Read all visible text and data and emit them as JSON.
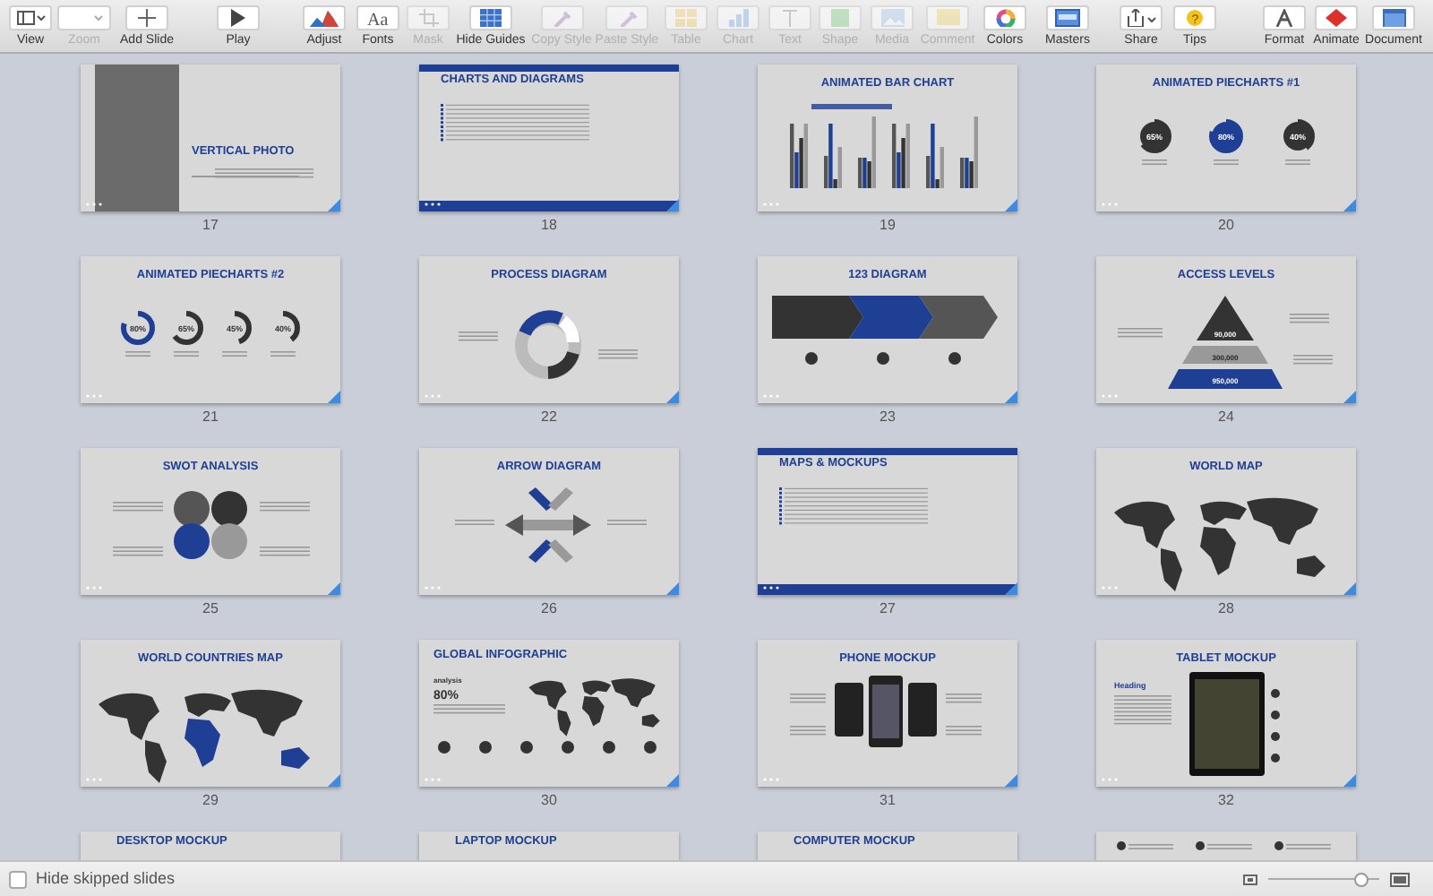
{
  "toolbar": {
    "groups": [
      {
        "items": [
          {
            "kind": "view",
            "label": "View",
            "disabled": false
          },
          {
            "kind": "zoom",
            "label": "Zoom",
            "disabled": true
          },
          {
            "kind": "add",
            "label": "Add Slide",
            "disabled": false
          }
        ]
      },
      {
        "items": [
          {
            "kind": "play",
            "label": "Play",
            "disabled": false
          }
        ]
      },
      {
        "items": [
          {
            "kind": "adjust",
            "label": "Adjust",
            "disabled": false
          },
          {
            "kind": "fonts",
            "label": "Fonts",
            "disabled": false,
            "glyph": "Aa"
          },
          {
            "kind": "mask",
            "label": "Mask",
            "disabled": true
          },
          {
            "kind": "guides",
            "label": "Hide Guides",
            "disabled": false
          },
          {
            "kind": "copystyle",
            "label": "Copy Style",
            "disabled": true
          },
          {
            "kind": "pastestyle",
            "label": "Paste Style",
            "disabled": true
          },
          {
            "kind": "table",
            "label": "Table",
            "disabled": true
          },
          {
            "kind": "chart",
            "label": "Chart",
            "disabled": true
          },
          {
            "kind": "text",
            "label": "Text",
            "disabled": true
          },
          {
            "kind": "shape",
            "label": "Shape",
            "disabled": true
          },
          {
            "kind": "media",
            "label": "Media",
            "disabled": true
          },
          {
            "kind": "comment",
            "label": "Comment",
            "disabled": true
          },
          {
            "kind": "colors",
            "label": "Colors",
            "disabled": false
          },
          {
            "kind": "masters",
            "label": "Masters",
            "disabled": false
          }
        ]
      },
      {
        "items": [
          {
            "kind": "share",
            "label": "Share",
            "disabled": false
          },
          {
            "kind": "tips",
            "label": "Tips",
            "disabled": false,
            "glyph": "?"
          }
        ]
      },
      {
        "items": [
          {
            "kind": "format",
            "label": "Format",
            "disabled": false
          },
          {
            "kind": "animate",
            "label": "Animate",
            "disabled": false
          },
          {
            "kind": "document",
            "label": "Document",
            "disabled": false
          }
        ]
      }
    ]
  },
  "slides": [
    {
      "number": "17",
      "kind": "photo",
      "title": "VERTICAL PHOTO"
    },
    {
      "number": "18",
      "kind": "list",
      "title": "CHARTS AND DIAGRAMS"
    },
    {
      "number": "19",
      "kind": "bars",
      "title": "ANIMATED BAR CHART"
    },
    {
      "number": "20",
      "kind": "pies",
      "title": "ANIMATED PIECHARTS #1",
      "values": [
        "65%",
        "80%",
        "40%"
      ]
    },
    {
      "number": "21",
      "kind": "pies",
      "title": "ANIMATED PIECHARTS #2",
      "values": [
        "80%",
        "65%",
        "45%",
        "40%"
      ]
    },
    {
      "number": "22",
      "kind": "cycle",
      "title": "PROCESS DIAGRAM"
    },
    {
      "number": "23",
      "kind": "chevrons",
      "title": "123 DIAGRAM"
    },
    {
      "number": "24",
      "kind": "pyramid",
      "title": "ACCESS LEVELS",
      "values": [
        "90,000",
        "300,000",
        "950,000"
      ]
    },
    {
      "number": "25",
      "kind": "venn",
      "title": "SWOT ANALYSIS"
    },
    {
      "number": "26",
      "kind": "arrows",
      "title": "ARROW DIAGRAM"
    },
    {
      "number": "27",
      "kind": "list",
      "title": "MAPS & MOCKUPS"
    },
    {
      "number": "28",
      "kind": "map",
      "title": "WORLD MAP"
    },
    {
      "number": "29",
      "kind": "map",
      "title": "WORLD COUNTRIES MAP"
    },
    {
      "number": "30",
      "kind": "infographic",
      "title": "GLOBAL INFOGRAPHIC",
      "values": [
        "analysis",
        "80%"
      ]
    },
    {
      "number": "31",
      "kind": "phones",
      "title": "PHONE MOCKUP"
    },
    {
      "number": "32",
      "kind": "tablet",
      "title": "TABLET MOCKUP",
      "values": [
        "Heading"
      ]
    },
    {
      "kind": "mockup",
      "title": "DESKTOP MOCKUP"
    },
    {
      "kind": "mockup",
      "title": "LAPTOP MOCKUP"
    },
    {
      "kind": "mockup",
      "title": "COMPUTER MOCKUP"
    },
    {
      "kind": "icons"
    }
  ],
  "status_bar": {
    "hide_skipped": {
      "label": "Hide skipped slides",
      "checked": false
    },
    "size_slider": {
      "level": 0.88
    }
  }
}
